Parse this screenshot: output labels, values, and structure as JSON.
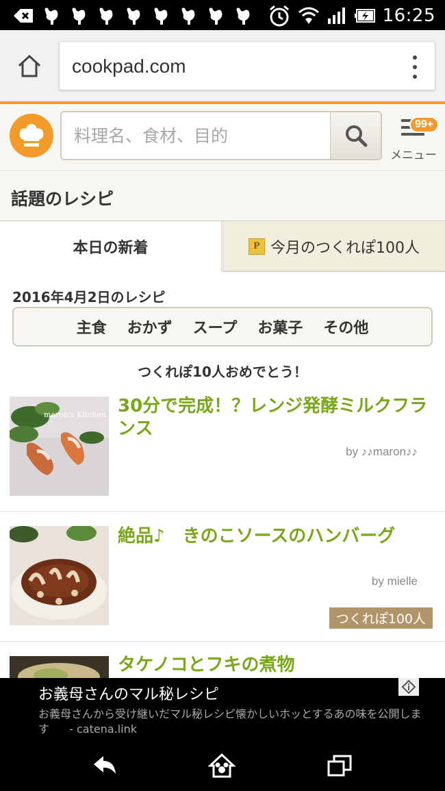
{
  "status_bar": {
    "time": "16:25",
    "icons": [
      "back-arrow-icon",
      "bird-icon",
      "alarm-icon",
      "wifi-icon",
      "signal-icon",
      "battery-icon"
    ]
  },
  "browser": {
    "url": "cookpad.com"
  },
  "header": {
    "search_placeholder": "料理名、食材、目的",
    "menu_label": "メニュー",
    "menu_badge": "99+"
  },
  "section": {
    "title": "話題のレシピ"
  },
  "tabs": [
    {
      "label": "本日の新着",
      "active": true
    },
    {
      "label": "今月のつくれぽ100人",
      "active": false,
      "icon_letter": "P"
    }
  ],
  "date_label": "2016年4月2日のレシピ",
  "categories": [
    "主食",
    "おかず",
    "スープ",
    "お菓子",
    "その他"
  ],
  "congrats": "つくれぽ10人おめでとう！",
  "recipes": [
    {
      "title": "30分で完成！？レンジ発酵ミルクフランス",
      "author": "by ♪♪maron♪♪",
      "thumb_text": "maron's Kitchen",
      "badge": ""
    },
    {
      "title": "絶品♪　きのこソースのハンバーグ",
      "author": "by mielle",
      "thumb_text": "",
      "badge": "つくれぽ100人"
    },
    {
      "title": "タケノコとフキの煮物",
      "author": "",
      "thumb_text": "",
      "badge": ""
    }
  ],
  "ad": {
    "title": "お義母さんのマル秘レシピ",
    "description": "お義母さんから受け継いだマル秘レシピ懐かしいホッとするあの味を公開します",
    "source": "- catena.link"
  },
  "colors": {
    "accent": "#f39a2b",
    "recipe_title": "#7aa619",
    "badge_bg": "#b29469",
    "header_bg": "#f7f6f0"
  }
}
